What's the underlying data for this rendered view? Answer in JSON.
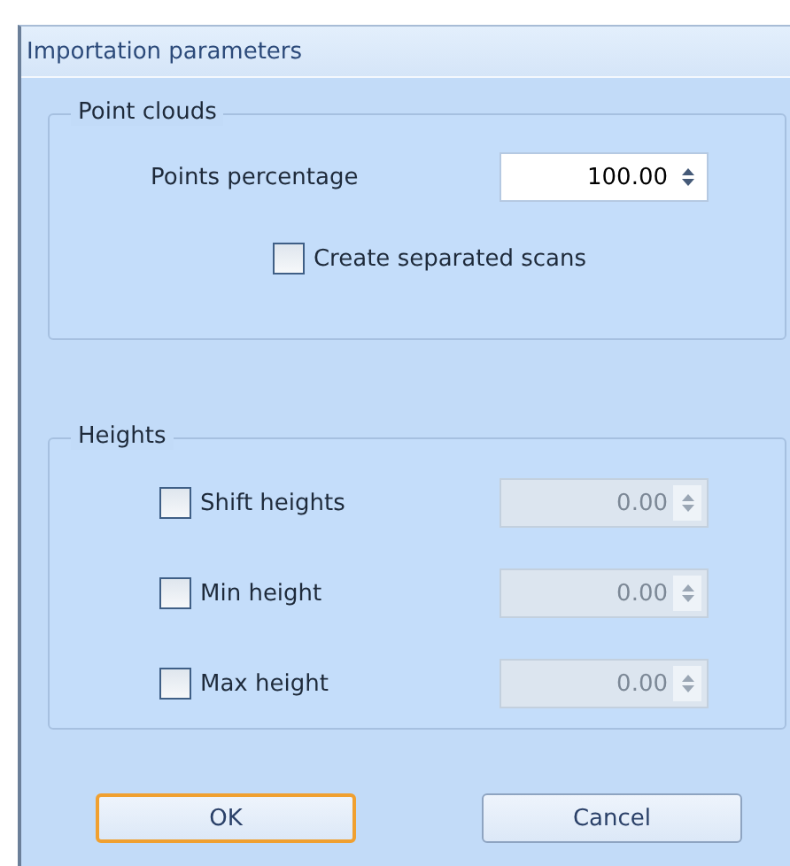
{
  "window": {
    "title": "Importation parameters"
  },
  "groups": [
    {
      "title": "Point clouds",
      "rows": [
        {
          "kind": "spin",
          "label": "Points percentage",
          "value": "100.00",
          "disabled": false
        },
        {
          "kind": "check",
          "label": "Create separated scans",
          "checked": false
        }
      ]
    },
    {
      "title": "Heights",
      "rows": [
        {
          "kind": "checkspin",
          "label": "Shift heights",
          "checked": false,
          "value": "0.00",
          "disabled": true
        },
        {
          "kind": "checkspin",
          "label": "Min height",
          "checked": false,
          "value": "0.00",
          "disabled": true
        },
        {
          "kind": "checkspin",
          "label": "Max height",
          "checked": false,
          "value": "0.00",
          "disabled": true
        }
      ]
    }
  ],
  "buttons": [
    {
      "label": "OK",
      "focused": true
    },
    {
      "label": "Cancel",
      "focused": false
    }
  ]
}
